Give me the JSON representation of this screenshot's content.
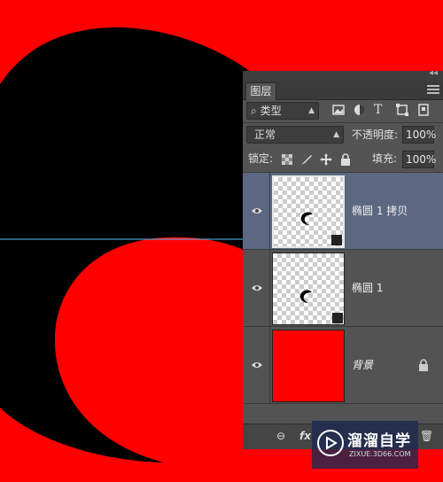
{
  "colors": {
    "canvas_background": "#fe0000",
    "shape_fill": "#000000",
    "guide_line": "#4fc3f7",
    "panel_bg": "#535353",
    "selected_layer_bg": "#5c6881"
  },
  "panel": {
    "collapse_glyph": "◂◂",
    "tab_label": "图层",
    "filter": {
      "search_glyph": "⌕",
      "kind_value": "类型"
    },
    "blend_mode": "正常",
    "opacity_label": "不透明度:",
    "opacity_value": "100%",
    "lock_label": "锁定:",
    "fill_label": "填充:",
    "fill_value": "100%"
  },
  "layers": [
    {
      "name": "椭圆 1 拷贝",
      "selected": true,
      "thumbnail": "transparent-with-shape"
    },
    {
      "name": "椭圆 1",
      "selected": false,
      "thumbnail": "transparent-with-shape"
    },
    {
      "name": "背景",
      "selected": false,
      "thumbnail": "solid-red",
      "locked": true
    }
  ],
  "bottom_bar": {
    "link_glyph": "⊖",
    "fx_label": "fx",
    "trash_glyph": "🗑"
  },
  "watermark": {
    "brand": "溜溜自学",
    "site": "ZIXUE.3D66.COM"
  }
}
